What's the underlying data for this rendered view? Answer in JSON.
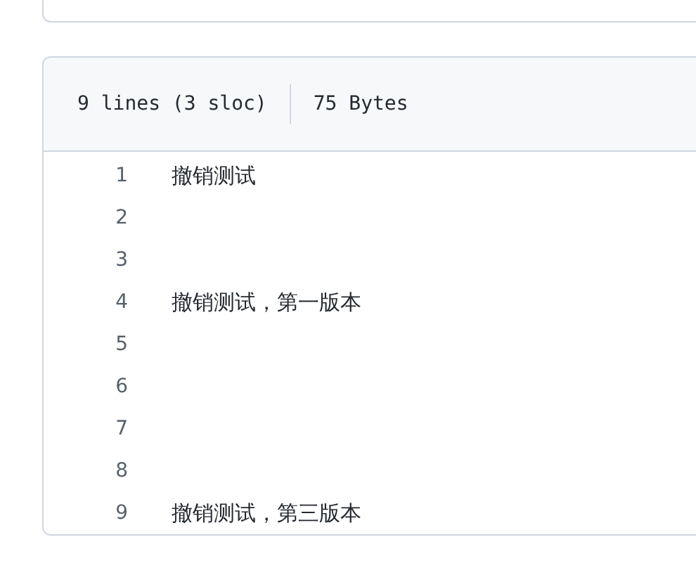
{
  "file_info": {
    "lines": "9 lines (3 sloc)",
    "size": "75 Bytes"
  },
  "code_lines": [
    {
      "number": "1",
      "text": "撤销测试"
    },
    {
      "number": "2"
    },
    {
      "number": "3"
    },
    {
      "number": "4",
      "text": "撤销测试，第一版本"
    },
    {
      "number": "5"
    },
    {
      "number": "6"
    },
    {
      "number": "7"
    },
    {
      "number": "8"
    },
    {
      "number": "9",
      "text": "撤销测试，第三版本"
    }
  ]
}
